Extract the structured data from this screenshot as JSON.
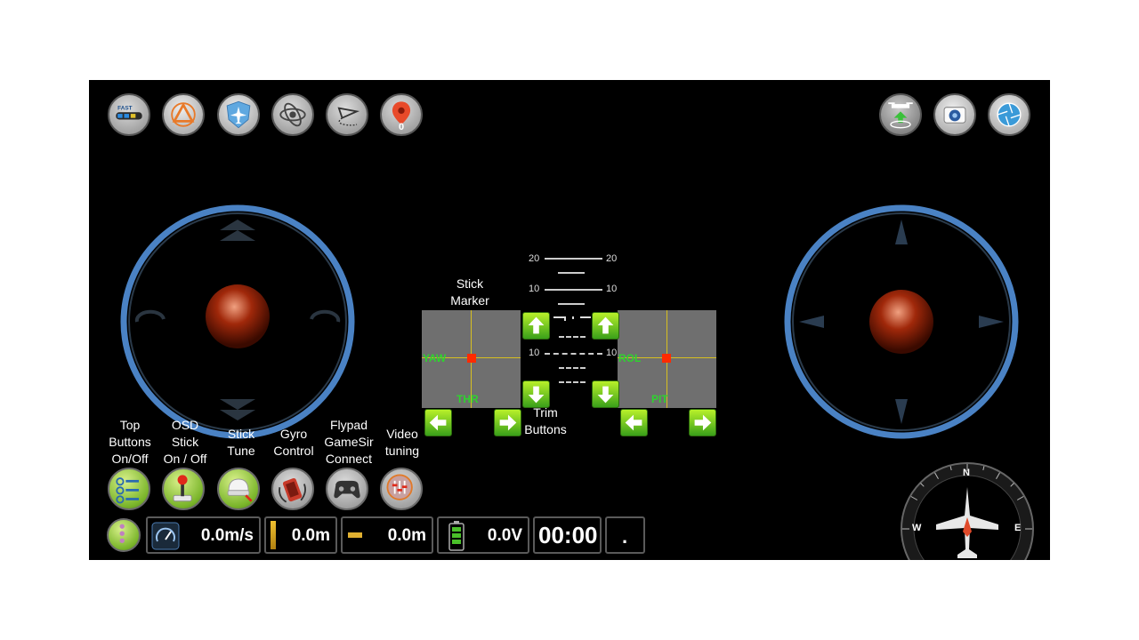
{
  "top_bar": {
    "left_buttons": [
      {
        "icon": "speed-fast-icon",
        "label": "FAST"
      },
      {
        "icon": "warning-triangle-icon"
      },
      {
        "icon": "airplane-shield-icon"
      },
      {
        "icon": "eye-orbit-icon"
      },
      {
        "icon": "paper-plane-path-icon"
      },
      {
        "icon": "map-pin-icon",
        "count": "0"
      }
    ],
    "right_buttons": [
      {
        "icon": "drone-return-icon"
      },
      {
        "icon": "camera-icon"
      },
      {
        "icon": "aperture-icon"
      }
    ]
  },
  "annotations": {
    "stick_marker": "Stick\nMarker",
    "trim_buttons": "Trim\nButtons",
    "top_buttons": "Top\nButtons\nOn/Off",
    "osd_stick": "OSD\nStick\nOn / Off",
    "stick_tune": "Stick\nTune",
    "gyro_control": "Gyro\nControl",
    "flypad": "Flypad\nGameSir\nConnect",
    "video_tuning": "Video\ntuning"
  },
  "stick_monitor": {
    "left": {
      "h_label": "YAW",
      "v_label": "THR"
    },
    "right": {
      "h_label": "ROL",
      "v_label": "PIT"
    }
  },
  "pitch_ladder": [
    "20",
    "20",
    "10",
    "10",
    "10",
    "10"
  ],
  "telemetry": {
    "speed": "0.0m/s",
    "altitude": "0.0m",
    "distance": "0.0m",
    "voltage": "0.0V",
    "timer": "00:00",
    "extra": "."
  },
  "compass": {
    "n": "N",
    "e": "E",
    "w": "W"
  },
  "colors": {
    "joystick_ring": "#4a82c4",
    "button_green": "#7ab52a",
    "marker_red": "#ff2a00",
    "axis_label_green": "#2fd22f",
    "crosshair_yellow": "#d8c020"
  }
}
